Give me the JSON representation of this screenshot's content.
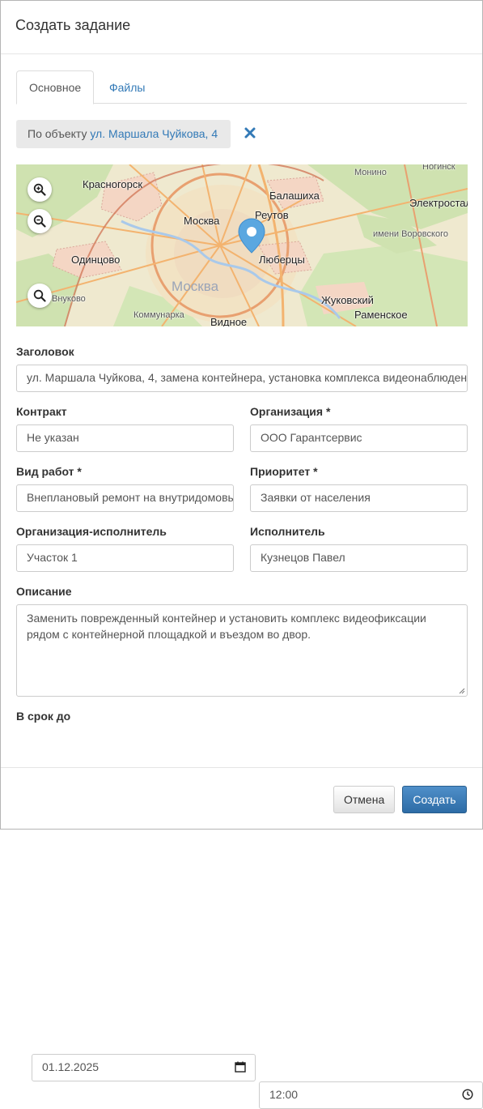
{
  "modal": {
    "title": "Создать задание"
  },
  "tabs": [
    {
      "label": "Основное",
      "active": true
    },
    {
      "label": "Файлы",
      "active": false
    }
  ],
  "object": {
    "prefix": "По объекту",
    "address": "ул. Маршала Чуйкова, 4"
  },
  "map": {
    "labels": {
      "krasnogorsk": "Красногорск",
      "balashikha": "Балашиха",
      "moskva": "Москва",
      "reutov": "Реутов",
      "odintsovo": "Одинцово",
      "lyubertsy": "Люберцы",
      "moskva_big": "Москва",
      "zhukovsky": "Жуковский",
      "ramenskoe": "Раменское",
      "kommunarka": "Коммунарка",
      "vidnoe": "Видное",
      "monino": "Монино",
      "noginsk": "Ногинск",
      "elektrostal": "Электросталь",
      "vorovskogo": "имени Воровского",
      "vnukovo": "Внуково"
    },
    "controls": [
      "zoom-in-icon",
      "zoom-out-icon",
      "search-icon"
    ],
    "marker_color": "#5aa7e0"
  },
  "form": {
    "title": {
      "label": "Заголовок",
      "value": "ул. Маршала Чуйкова, 4, замена контейнера, установка комплекса видеонаблюдения"
    },
    "contract": {
      "label": "Контракт",
      "value": "Не указан"
    },
    "organization": {
      "label": "Организация *",
      "value": "ООО Гарантсервис"
    },
    "work_type": {
      "label": "Вид работ *",
      "value": "Внеплановый ремонт на внутридомовых"
    },
    "priority": {
      "label": "Приоритет *",
      "value": "Заявки от населения"
    },
    "executor_org": {
      "label": "Организация-исполнитель",
      "value": "Участок 1"
    },
    "executor": {
      "label": "Исполнитель",
      "value": "Кузнецов Павел"
    },
    "description": {
      "label": "Описание",
      "value": "Заменить поврежденный контейнер и установить комплекс видеофиксации рядом с контейнерной площадкой и въездом во двор."
    },
    "deadline": {
      "label": "В срок до",
      "date": "01.12.2025",
      "time": "12:00"
    }
  },
  "footer": {
    "cancel": "Отмена",
    "create": "Создать"
  },
  "colors": {
    "link": "#337ab7",
    "primary": "#337ab7"
  }
}
